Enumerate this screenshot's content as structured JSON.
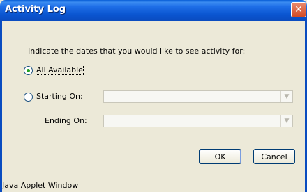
{
  "window": {
    "title": "Activity Log",
    "close_icon": "close-icon"
  },
  "dialog": {
    "instruction": "Indicate the dates that you would like to see activity for:",
    "options": {
      "all_available": {
        "label": "All Available",
        "selected": true
      },
      "starting_on": {
        "label": "Starting On:",
        "selected": false,
        "value": ""
      }
    },
    "ending_on": {
      "label": "Ending On:",
      "value": ""
    }
  },
  "buttons": {
    "ok": "OK",
    "cancel": "Cancel"
  },
  "status_text": "Java Applet Window",
  "colors": {
    "titlebar": "#0a55d0",
    "background": "#ece9d8",
    "radio_dot": "#21a121"
  }
}
